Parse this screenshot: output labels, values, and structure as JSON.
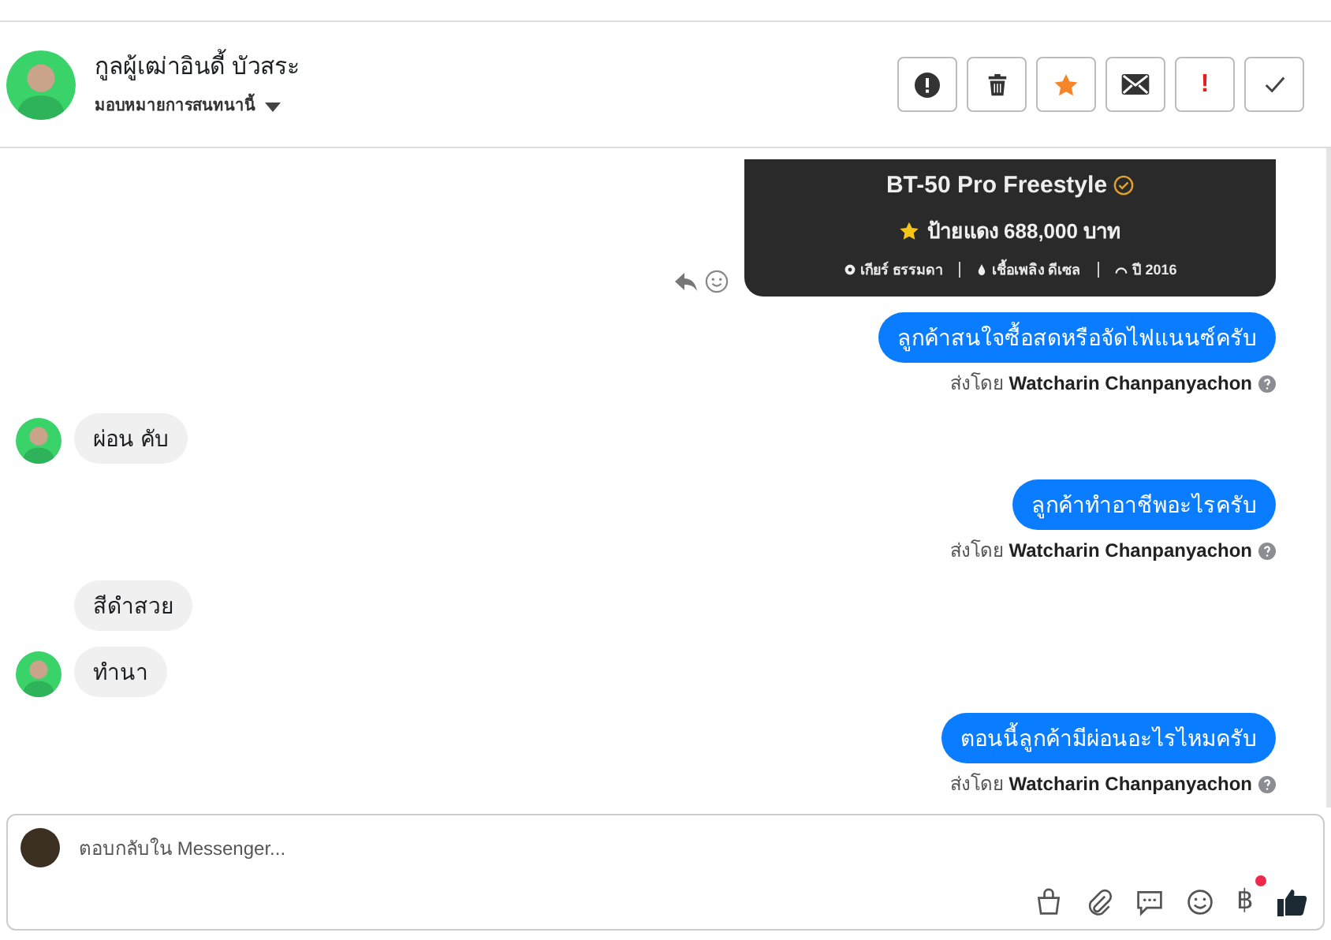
{
  "header": {
    "name": "กูลผู้เฒ่าอินดี้ บัวสระ",
    "assign": "มอบหมายการสนทนานี้",
    "actions": [
      {
        "kind": "alert"
      },
      {
        "kind": "trash"
      },
      {
        "kind": "star"
      },
      {
        "kind": "mail"
      },
      {
        "kind": "exclaim",
        "text": "!"
      },
      {
        "kind": "check"
      }
    ]
  },
  "messages": [
    {
      "kind": "card",
      "title": "BT-50 Pro Freestyle",
      "price": "ป้ายแดง 688,000 บาท",
      "specs": [
        {
          "text": "เกียร์ ธรรมดา"
        },
        {
          "text": "เชื้อเพลิง ดีเซล"
        },
        {
          "text": "ปี 2016"
        }
      ]
    },
    {
      "kind": "outgoing",
      "text": "ลูกค้าสนใจซื้อสดหรือจัดไฟแนนซ์ครับ",
      "sent_label": "ส่งโดย",
      "sender": "Watcharin Chanpanyachon"
    },
    {
      "kind": "incoming",
      "text": "ผ่อน คับ",
      "avatar": true
    },
    {
      "kind": "outgoing",
      "text": "ลูกค้าทำอาชีพอะไรครับ",
      "sent_label": "ส่งโดย",
      "sender": "Watcharin Chanpanyachon"
    },
    {
      "kind": "incoming",
      "text": "สีดำสวย",
      "avatar": false
    },
    {
      "kind": "incoming",
      "text": "ทำนา",
      "avatar": true
    },
    {
      "kind": "outgoing",
      "text": "ตอนนี้ลูกค้ามีผ่อนอะไรไหมครับ",
      "sent_label": "ส่งโดย",
      "sender": "Watcharin Chanpanyachon"
    }
  ],
  "composer": {
    "placeholder": "ตอบกลับใน Messenger...",
    "tools": [
      {
        "kind": "bag"
      },
      {
        "kind": "clip"
      },
      {
        "kind": "chat"
      },
      {
        "kind": "smile"
      },
      {
        "kind": "baht",
        "text": "฿",
        "badge": true
      },
      {
        "kind": "like"
      }
    ]
  }
}
